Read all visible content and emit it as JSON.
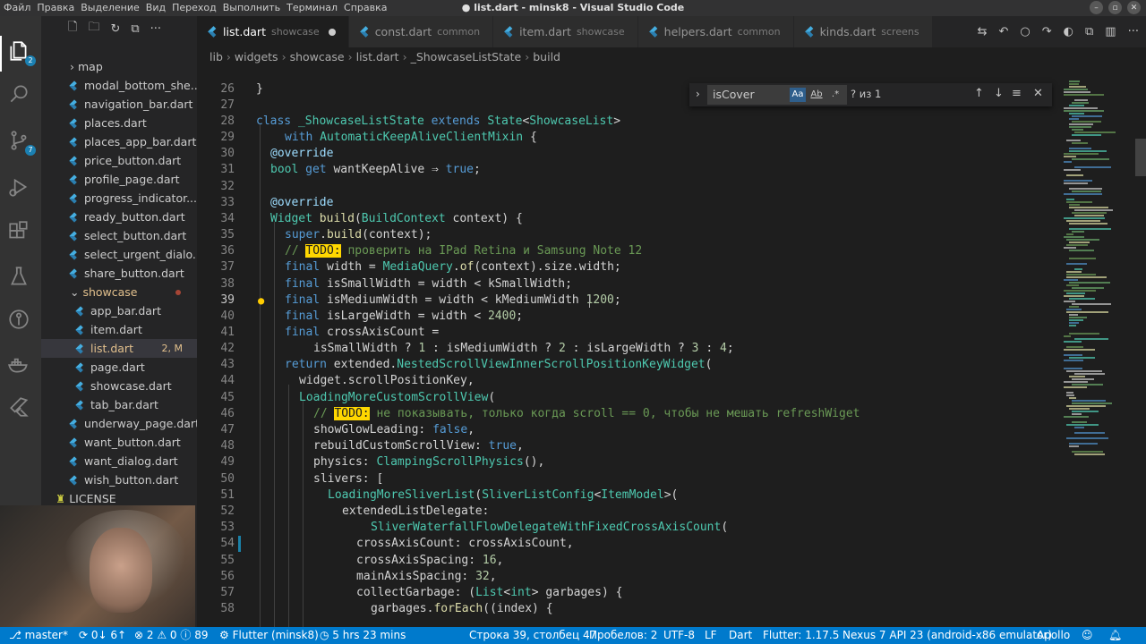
{
  "window": {
    "title": "● list.dart - minsk8 - Visual Studio Code",
    "menu": [
      "Файл",
      "Правка",
      "Выделение",
      "Вид",
      "Переход",
      "Выполнить",
      "Терминал",
      "Справка"
    ]
  },
  "activity_bar": {
    "explorer_badge": "2",
    "scm_badge": "7"
  },
  "sidebar": {
    "items": [
      {
        "label": "map",
        "kind": "folder"
      },
      {
        "label": "modal_bottom_she..."
      },
      {
        "label": "navigation_bar.dart"
      },
      {
        "label": "places.dart"
      },
      {
        "label": "places_app_bar.dart"
      },
      {
        "label": "price_button.dart"
      },
      {
        "label": "profile_page.dart"
      },
      {
        "label": "progress_indicator...."
      },
      {
        "label": "ready_button.dart"
      },
      {
        "label": "select_button.dart"
      },
      {
        "label": "select_urgent_dialo..."
      },
      {
        "label": "share_button.dart"
      },
      {
        "label": "showcase",
        "kind": "open-folder"
      },
      {
        "label": "app_bar.dart"
      },
      {
        "label": "item.dart"
      },
      {
        "label": "list.dart",
        "git": "2, M"
      },
      {
        "label": "page.dart"
      },
      {
        "label": "showcase.dart"
      },
      {
        "label": "tab_bar.dart"
      },
      {
        "label": "underway_page.dart"
      },
      {
        "label": "want_button.dart"
      },
      {
        "label": "want_dialog.dart"
      },
      {
        "label": "wish_button.dart"
      },
      {
        "label": "LICENSE"
      }
    ]
  },
  "tabs": [
    {
      "label": "list.dart",
      "desc": "showcase"
    },
    {
      "label": "const.dart",
      "desc": "common"
    },
    {
      "label": "item.dart",
      "desc": "showcase"
    },
    {
      "label": "helpers.dart",
      "desc": "common"
    },
    {
      "label": "kinds.dart",
      "desc": "screens"
    }
  ],
  "breadcrumb": [
    "lib",
    "widgets",
    "showcase",
    "list.dart",
    "_ShowcaseListState",
    "build"
  ],
  "find": {
    "query": "isCover",
    "opt_case": "Aa",
    "opt_word": "Ab",
    "opt_regex": ".*",
    "result": "? из 1"
  },
  "line_numbers": [
    "26",
    "27",
    "28",
    "29",
    "30",
    "31",
    "32",
    "33",
    "34",
    "35",
    "36",
    "37",
    "38",
    "39",
    "40",
    "41",
    "42",
    "43",
    "44",
    "45",
    "46",
    "47",
    "48",
    "49",
    "50",
    "51",
    "52",
    "53",
    "54",
    "55",
    "56",
    "57",
    "58"
  ],
  "code": {
    "l26": "}",
    "l28_a": "class ",
    "l28_b": "_ShowcaseListState",
    "l28_c": " extends ",
    "l28_d": "State",
    "l28_e": "<",
    "l28_f": "ShowcaseList",
    "l28_g": ">",
    "l29_a": "with ",
    "l29_b": "AutomaticKeepAliveClientMixin",
    "l29_c": " {",
    "l30": "@override",
    "l31_a": "bool",
    "l31_b": " get ",
    "l31_c": "wantKeepAlive",
    "l31_d": " ⇒ ",
    "l31_e": "true",
    "l31_f": ";",
    "l33": "@override",
    "l34_a": "Widget",
    "l34_b": " build",
    "l34_c": "(",
    "l34_d": "BuildContext",
    "l34_e": " context) {",
    "l35_a": "super",
    "l35_b": ".",
    "l35_c": "build",
    "l35_d": "(context);",
    "l36_a": "// ",
    "l36_b": "TODO:",
    "l36_c": " проверить на IPad Retina и Samsung Note 12",
    "l37_a": "final",
    "l37_b": " width = ",
    "l37_c": "MediaQuery",
    "l37_d": ".",
    "l37_e": "of",
    "l37_f": "(context).size.width;",
    "l38_a": "final",
    "l38_b": " isSmallWidth = width < kSmallWidth;",
    "l39_a": "final",
    "l39_b": " isMediumWidth = width < kMediumWidth",
    "l39_c": " 1200",
    "l39_d": ";",
    "l40_a": "final",
    "l40_b": " isLargeWidth = width < ",
    "l40_c": "2400",
    "l40_d": ";",
    "l41_a": "final",
    "l41_b": " crossAxisCount =",
    "l42_a": "isSmallWidth ? ",
    "l42_b": "1",
    "l42_c": " : isMediumWidth ? ",
    "l42_d": "2",
    "l42_e": " : isLargeWidth ? ",
    "l42_f": "3",
    "l42_g": " : ",
    "l42_h": "4",
    "l42_i": ";",
    "l43_a": "return",
    "l43_b": " extended.",
    "l43_c": "NestedScrollViewInnerScrollPositionKeyWidget",
    "l43_d": "(",
    "l44": "widget.scrollPositionKey,",
    "l45_a": "LoadingMoreCustomScrollView",
    "l45_b": "(",
    "l46_a": "// ",
    "l46_b": "TODO:",
    "l46_c": " не показывать, только когда scroll == 0, чтобы не мешать refreshWiget",
    "l47_a": "showGlowLeading: ",
    "l47_b": "false",
    "l47_c": ",",
    "l48_a": "rebuildCustomScrollView: ",
    "l48_b": "true",
    "l48_c": ",",
    "l49_a": "physics: ",
    "l49_b": "ClampingScrollPhysics",
    "l49_c": "(),",
    "l50": "slivers: [",
    "l51_a": "LoadingMoreSliverList",
    "l51_b": "(",
    "l51_c": "SliverListConfig",
    "l51_d": "<",
    "l51_e": "ItemModel",
    "l51_f": ">(",
    "l52": "extendedListDelegate:",
    "l53_a": "SliverWaterfallFlowDelegateWithFixedCrossAxisCount",
    "l53_b": "(",
    "l54": "crossAxisCount: crossAxisCount,",
    "l55_a": "crossAxisSpacing: ",
    "l55_b": "16",
    "l55_c": ",",
    "l56_a": "mainAxisSpacing: ",
    "l56_b": "32",
    "l56_c": ",",
    "l57_a": "collectGarbage: (",
    "l57_b": "List",
    "l57_c": "<",
    "l57_d": "int",
    "l57_e": "> garbages) {",
    "l58_a": "garbages.",
    "l58_b": "forEach",
    "l58_c": "((index) {"
  },
  "status": {
    "branch": "master*",
    "sync": "0↓ 6↑",
    "errors": "2",
    "warnings": "0",
    "info": "89",
    "flutter_session": "Flutter (minsk8)",
    "time": "5 hrs 23 mins",
    "position": "Строка 39, столбец 47",
    "spaces": "Пробелов: 2",
    "encoding": "UTF-8",
    "eol": "LF",
    "language": "Dart",
    "flutter_version": "Flutter: 1.17.5",
    "device": "Nexus 7 API 23 (android-x86 emulator)",
    "apollo": "Apollo"
  },
  "colors": {
    "statusbar": "#007acc",
    "keyword": "#569cd6",
    "type": "#4ec9b0",
    "function": "#dcdcaa",
    "number": "#b5cea8",
    "comment": "#6a9955",
    "todo_highlight": "#ffd700"
  }
}
